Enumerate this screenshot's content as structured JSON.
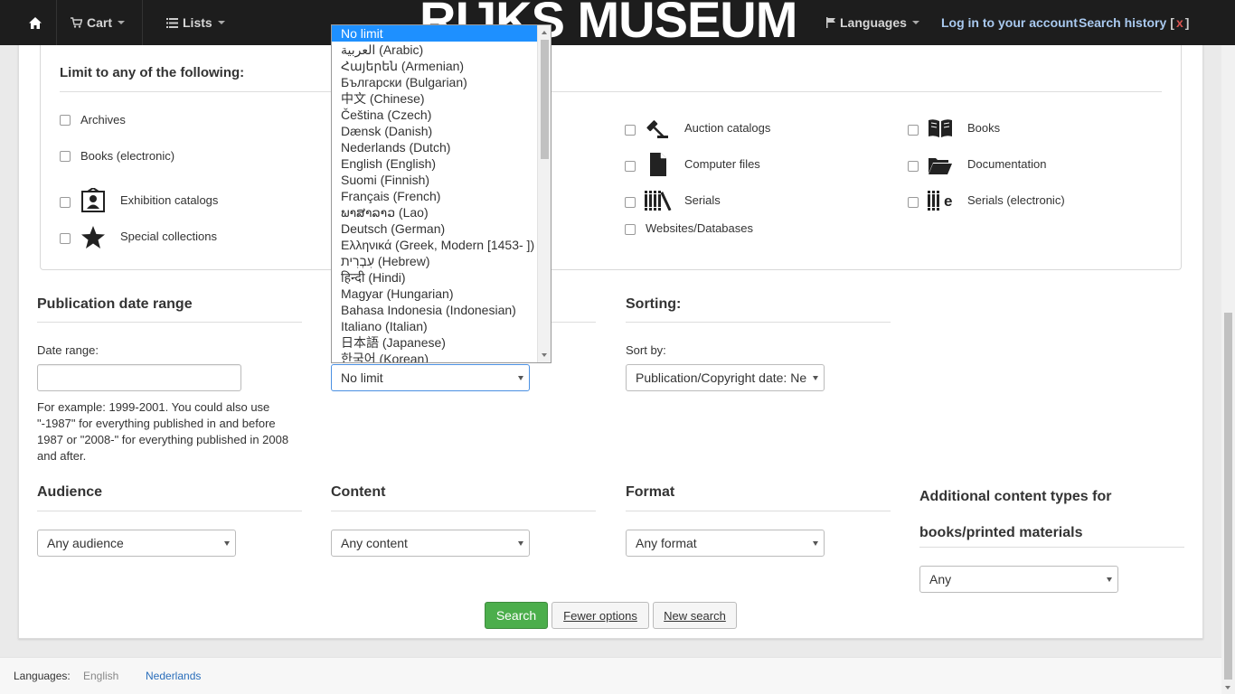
{
  "navbar": {
    "cart_label": "Cart",
    "lists_label": "Lists",
    "brand": "RIJKS MUSEUM",
    "languages_label": "Languages",
    "login_label": "Log in to your account",
    "history_label": "Search history",
    "history_open": "[",
    "history_clear": "x",
    "history_close": "]"
  },
  "limit": {
    "legend": "Limit to any of the following:",
    "types": [
      {
        "label": "Archives",
        "icon": "none"
      },
      {
        "label": "Auction catalogs",
        "icon": "gavel-icon"
      },
      {
        "label": "Books",
        "icon": "book-icon"
      },
      {
        "label": "Books (electronic)",
        "icon": "none"
      },
      {
        "label": "Computer files",
        "icon": "file-icon"
      },
      {
        "label": "Documentation",
        "icon": "folder-open-icon"
      },
      {
        "label": "Exhibition catalogs",
        "icon": "portrait-icon"
      },
      {
        "label": "Serials",
        "icon": "serials-icon"
      },
      {
        "label": "Serials (electronic)",
        "icon": "serials-electronic-icon"
      },
      {
        "label": "Special collections",
        "icon": "star-icon"
      },
      {
        "label": "Websites/Databases",
        "icon": "none"
      }
    ]
  },
  "pubdate": {
    "title": "Publication date range",
    "date_label": "Date range:",
    "date_value": "",
    "hint": "For example: 1999-2001. You could also use \"-1987\" for everything published in and before 1987 or \"2008-\" for everything published in 2008 and after."
  },
  "language": {
    "selected": "No limit",
    "options": [
      "No limit",
      "العربية (Arabic)",
      "Հայերեն (Armenian)",
      "Български (Bulgarian)",
      "中文 (Chinese)",
      "Čeština (Czech)",
      "Dænsk (Danish)",
      "Nederlands (Dutch)",
      "English (English)",
      "Suomi (Finnish)",
      "Français (French)",
      "ພາສາລາວ (Lao)",
      "Deutsch (German)",
      "Ελληνικά (Greek, Modern [1453- ])",
      "עִבְרִית (Hebrew)",
      "हिन्दी (Hindi)",
      "Magyar (Hungarian)",
      "Bahasa Indonesia (Indonesian)",
      "Italiano (Italian)",
      "日本語 (Japanese)",
      "한국어 (Korean)"
    ]
  },
  "sorting": {
    "title": "Sorting:",
    "sort_label": "Sort by:",
    "sort_value": "Publication/Copyright date: Ne"
  },
  "audience": {
    "title": "Audience",
    "value": "Any audience"
  },
  "content": {
    "title": "Content",
    "value": "Any content"
  },
  "format": {
    "title": "Format",
    "value": "Any format"
  },
  "additional": {
    "title": "Additional content types for books/printed materials",
    "value": "Any"
  },
  "buttons": {
    "search": "Search",
    "fewer": "Fewer options",
    "new_search": "New search"
  },
  "footer": {
    "label": "Languages:",
    "current": "English",
    "other": "Nederlands"
  },
  "colors": {
    "navbar": "#1d1d1d",
    "search_button": "#4cae4c",
    "link": "#2a6ebb",
    "dropdown_selected": "#1e90ff"
  }
}
